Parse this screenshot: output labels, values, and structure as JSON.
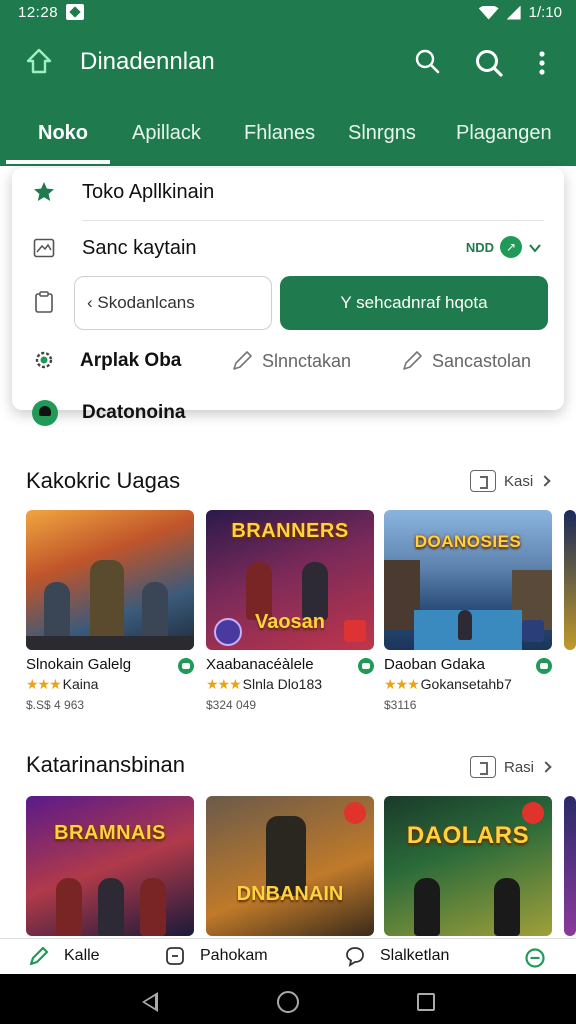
{
  "status_bar": {
    "time": "12:28",
    "right_text": "1/:10"
  },
  "app_bar": {
    "title": "Dinadennlan"
  },
  "tabs": [
    {
      "label": "Noko",
      "active": true
    },
    {
      "label": "Apillack",
      "active": false
    },
    {
      "label": "Fhlanes",
      "active": false
    },
    {
      "label": "Slnrgns",
      "active": false
    },
    {
      "label": "Plagangen",
      "active": false
    }
  ],
  "menu": {
    "header": "Toko Apllkinain",
    "sort_label": "Sanc kaytain",
    "sort_badge": "NDD",
    "sort_badge_dot": "↗",
    "input_value": "‹ Skodanlcans",
    "primary_button": "Y sehcadnraf hqota",
    "category_label": "Arplak Oba",
    "option_1": "Slnnctakan",
    "option_2": "Sancastolan",
    "peek_label": "Dcatonoina"
  },
  "section1": {
    "title": "Kakokric Uagas",
    "more_label": "Kasi",
    "games": [
      {
        "name": "Slnokain Galelg",
        "rating": "Kaina",
        "size": "$.S$ 4 963",
        "thumb_title": ""
      },
      {
        "name": "Xaabanacéàlele",
        "rating": "Slnla Dlo183",
        "size": "$324 049",
        "thumb_title": "BRANNERS",
        "thumb_title2": "Vaosan"
      },
      {
        "name": "Daoban Gdaka",
        "rating": "Gokansetahb7",
        "size": "$3116",
        "thumb_title": "DOANOSIES"
      },
      {
        "name": "K",
        "rating": "",
        "size": "S",
        "thumb_title": ""
      }
    ]
  },
  "section2": {
    "title": "Katarinansbinan",
    "more_label": "Rasi",
    "games": [
      {
        "thumb_title": "BRAMNAIS"
      },
      {
        "thumb_title": "DNBANAIN"
      },
      {
        "thumb_title": "DAOLARS"
      },
      {
        "thumb_title": ""
      }
    ]
  },
  "bottom_nav": [
    {
      "label": "Kalle"
    },
    {
      "label": "Pahokam"
    },
    {
      "label": "Slalketlan"
    }
  ],
  "colors": {
    "primary": "#1f7a4d",
    "accent": "#1f9a58",
    "star": "#e8a317"
  }
}
